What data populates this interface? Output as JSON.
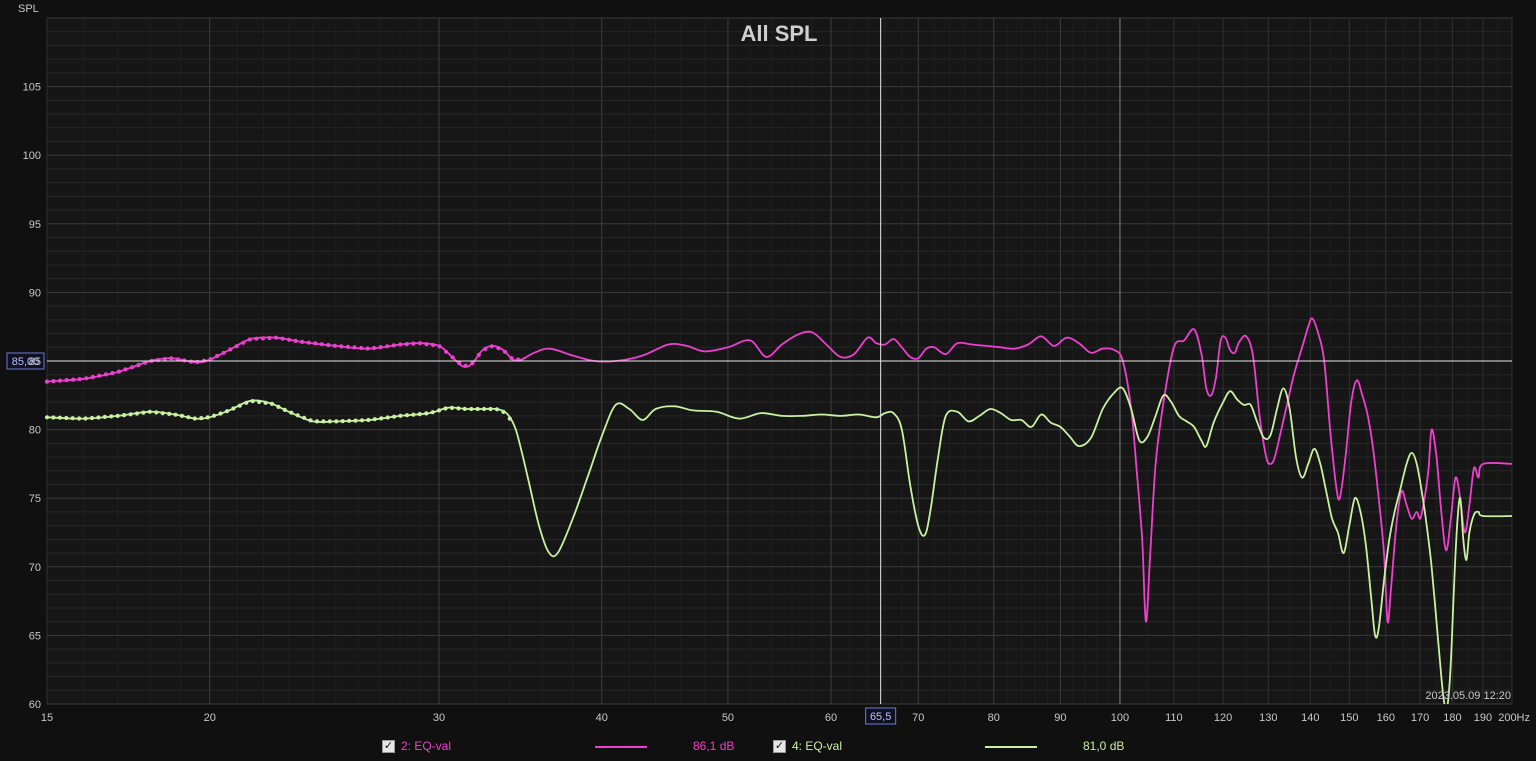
{
  "chart_data": {
    "type": "line",
    "title": "All SPL",
    "ylabel": "SPL",
    "x_scale": "log",
    "xlim": [
      15,
      200
    ],
    "ylim": [
      60,
      110
    ],
    "x_ticks": [
      {
        "value": 15,
        "label": "15"
      },
      {
        "value": 20,
        "label": "20"
      },
      {
        "value": 30,
        "label": "30"
      },
      {
        "value": 40,
        "label": "40"
      },
      {
        "value": 50,
        "label": "50"
      },
      {
        "value": 60,
        "label": "60"
      },
      {
        "value": 70,
        "label": "70"
      },
      {
        "value": 80,
        "label": "80"
      },
      {
        "value": 90,
        "label": "90"
      },
      {
        "value": 100,
        "label": "100"
      },
      {
        "value": 110,
        "label": "110"
      },
      {
        "value": 120,
        "label": "120"
      },
      {
        "value": 130,
        "label": "130"
      },
      {
        "value": 140,
        "label": "140"
      },
      {
        "value": 150,
        "label": "150"
      },
      {
        "value": 160,
        "label": "160"
      },
      {
        "value": 170,
        "label": "170"
      },
      {
        "value": 180,
        "label": "180"
      },
      {
        "value": 190,
        "label": "190"
      },
      {
        "value": 200,
        "label": "200Hz"
      }
    ],
    "y_ticks": [
      60,
      65,
      70,
      75,
      80,
      85,
      90,
      95,
      100,
      105
    ],
    "grid": true,
    "cursor": {
      "x": 65.5,
      "x_label": "65,5",
      "y": 85.0,
      "y_label": "85,00"
    },
    "timestamp": "2023.05.09 12:20",
    "series": [
      {
        "name": "2: EQ-val",
        "color": "#ee3fcf",
        "legend_value": "86,1 dB",
        "checked": true,
        "markers_until": 34.5,
        "points": [
          [
            15,
            83.5
          ],
          [
            16,
            83.7
          ],
          [
            17,
            84.2
          ],
          [
            18,
            85.0
          ],
          [
            18.7,
            85.2
          ],
          [
            19.5,
            84.9
          ],
          [
            20,
            85.1
          ],
          [
            20.7,
            85.8
          ],
          [
            21.5,
            86.6
          ],
          [
            22.5,
            86.7
          ],
          [
            23.5,
            86.4
          ],
          [
            25,
            86.1
          ],
          [
            26.5,
            85.9
          ],
          [
            28,
            86.2
          ],
          [
            29,
            86.3
          ],
          [
            30,
            86.1
          ],
          [
            30.7,
            85.3
          ],
          [
            31.3,
            84.6
          ],
          [
            31.8,
            84.8
          ],
          [
            32.4,
            85.8
          ],
          [
            33,
            86.1
          ],
          [
            33.6,
            85.8
          ],
          [
            34.2,
            85.1
          ],
          [
            34.7,
            85.1
          ],
          [
            35.5,
            85.6
          ],
          [
            36.5,
            85.9
          ],
          [
            38,
            85.4
          ],
          [
            39.5,
            85.0
          ],
          [
            41,
            85.0
          ],
          [
            43,
            85.4
          ],
          [
            45,
            86.2
          ],
          [
            46.5,
            86.1
          ],
          [
            48,
            85.7
          ],
          [
            50,
            86.0
          ],
          [
            52,
            86.5
          ],
          [
            53.5,
            85.3
          ],
          [
            55,
            86.2
          ],
          [
            56.5,
            86.9
          ],
          [
            58,
            87.1
          ],
          [
            59.5,
            86.2
          ],
          [
            61,
            85.3
          ],
          [
            62.5,
            85.5
          ],
          [
            64,
            86.7
          ],
          [
            65,
            86.3
          ],
          [
            66,
            86.2
          ],
          [
            67,
            86.6
          ],
          [
            68,
            86.0
          ],
          [
            69,
            85.3
          ],
          [
            70,
            85.2
          ],
          [
            71,
            85.9
          ],
          [
            72,
            86.0
          ],
          [
            73.5,
            85.5
          ],
          [
            75,
            86.3
          ],
          [
            77,
            86.2
          ],
          [
            79,
            86.1
          ],
          [
            81,
            86.0
          ],
          [
            83,
            85.9
          ],
          [
            85,
            86.2
          ],
          [
            87,
            86.8
          ],
          [
            89,
            86.1
          ],
          [
            91,
            86.7
          ],
          [
            93,
            86.3
          ],
          [
            95,
            85.6
          ],
          [
            97,
            85.9
          ],
          [
            99,
            85.8
          ],
          [
            100.5,
            85.0
          ],
          [
            102,
            81.5
          ],
          [
            103,
            77
          ],
          [
            104,
            72
          ],
          [
            104.7,
            66.0
          ],
          [
            105.5,
            71
          ],
          [
            106.5,
            77.5
          ],
          [
            108,
            82
          ],
          [
            110,
            86.0
          ],
          [
            112,
            86.5
          ],
          [
            114,
            87.3
          ],
          [
            115.5,
            85.5
          ],
          [
            116.5,
            83
          ],
          [
            117.5,
            82.5
          ],
          [
            118.5,
            83.8
          ],
          [
            119.5,
            86.5
          ],
          [
            120.5,
            86.7
          ],
          [
            121.5,
            85.8
          ],
          [
            122.5,
            85.6
          ],
          [
            123.5,
            86.4
          ],
          [
            125,
            86.8
          ],
          [
            126.5,
            85.4
          ],
          [
            128,
            81
          ],
          [
            129.5,
            78
          ],
          [
            130.5,
            77.5
          ],
          [
            131.5,
            78
          ],
          [
            133,
            80
          ],
          [
            134.5,
            82
          ],
          [
            136,
            84
          ],
          [
            138,
            86
          ],
          [
            139.5,
            87.5
          ],
          [
            140.5,
            88.1
          ],
          [
            142,
            87
          ],
          [
            143.5,
            85
          ],
          [
            145,
            80
          ],
          [
            146.5,
            76
          ],
          [
            147.5,
            75
          ],
          [
            149,
            78
          ],
          [
            150.5,
            82
          ],
          [
            152,
            83.6
          ],
          [
            153.5,
            82.5
          ],
          [
            155,
            81
          ],
          [
            156.5,
            78.5
          ],
          [
            158,
            75
          ],
          [
            159.5,
            71
          ],
          [
            160.5,
            66
          ],
          [
            161.5,
            68.5
          ],
          [
            163,
            73
          ],
          [
            164.5,
            75.5
          ],
          [
            166,
            74.5
          ],
          [
            167.5,
            73.5
          ],
          [
            169,
            74
          ],
          [
            170,
            73.5
          ],
          [
            171,
            74.5
          ],
          [
            172.5,
            77
          ],
          [
            173.5,
            80
          ],
          [
            175,
            78
          ],
          [
            176.5,
            74
          ],
          [
            178,
            71.2
          ],
          [
            179.5,
            73.5
          ],
          [
            181,
            76.5
          ],
          [
            182.5,
            75
          ],
          [
            184,
            72.5
          ],
          [
            185.5,
            74.5
          ],
          [
            187,
            77.2
          ],
          [
            188.5,
            76.5
          ],
          [
            190,
            77.5
          ],
          [
            200,
            77.5
          ]
        ]
      },
      {
        "name": "4: EQ-val",
        "color": "#c8f2a0",
        "legend_value": "81,0 dB",
        "checked": true,
        "markers_until": 34.0,
        "points": [
          [
            15,
            80.9
          ],
          [
            16,
            80.8
          ],
          [
            17,
            81.0
          ],
          [
            18,
            81.3
          ],
          [
            18.8,
            81.1
          ],
          [
            19.5,
            80.8
          ],
          [
            20,
            80.9
          ],
          [
            20.7,
            81.4
          ],
          [
            21.5,
            82.1
          ],
          [
            22.3,
            81.9
          ],
          [
            23,
            81.3
          ],
          [
            24,
            80.6
          ],
          [
            25,
            80.6
          ],
          [
            26.5,
            80.7
          ],
          [
            28,
            81.0
          ],
          [
            29.5,
            81.2
          ],
          [
            30.5,
            81.6
          ],
          [
            31.5,
            81.5
          ],
          [
            32.5,
            81.5
          ],
          [
            33.2,
            81.5
          ],
          [
            33.8,
            81.2
          ],
          [
            34.3,
            80.2
          ],
          [
            34.7,
            78.5
          ],
          [
            35.2,
            76
          ],
          [
            35.8,
            73
          ],
          [
            36.4,
            71.1
          ],
          [
            37,
            71
          ],
          [
            38,
            73.5
          ],
          [
            39,
            76.5
          ],
          [
            40,
            79.5
          ],
          [
            41,
            81.8
          ],
          [
            42,
            81.5
          ],
          [
            43,
            80.7
          ],
          [
            44,
            81.5
          ],
          [
            45.5,
            81.7
          ],
          [
            47,
            81.4
          ],
          [
            49,
            81.3
          ],
          [
            51,
            80.8
          ],
          [
            53,
            81.2
          ],
          [
            55,
            81.0
          ],
          [
            57,
            81.0
          ],
          [
            59,
            81.1
          ],
          [
            61,
            81.0
          ],
          [
            63,
            81.1
          ],
          [
            65,
            80.9
          ],
          [
            66,
            81.2
          ],
          [
            67,
            81.2
          ],
          [
            68,
            80
          ],
          [
            69,
            76
          ],
          [
            70,
            73
          ],
          [
            70.8,
            72.3
          ],
          [
            71.5,
            74
          ],
          [
            72.5,
            78
          ],
          [
            73.5,
            81
          ],
          [
            75,
            81.3
          ],
          [
            76.5,
            80.6
          ],
          [
            78,
            81
          ],
          [
            79.5,
            81.5
          ],
          [
            81,
            81.2
          ],
          [
            82.5,
            80.7
          ],
          [
            84,
            80.7
          ],
          [
            85.5,
            80.2
          ],
          [
            87,
            81.1
          ],
          [
            88.5,
            80.5
          ],
          [
            90,
            80.2
          ],
          [
            91.5,
            79.5
          ],
          [
            93,
            78.8
          ],
          [
            95,
            79.4
          ],
          [
            97,
            81.5
          ],
          [
            99,
            82.7
          ],
          [
            100.5,
            83.0
          ],
          [
            102,
            81.5
          ],
          [
            103.5,
            79.2
          ],
          [
            105,
            79.5
          ],
          [
            106.5,
            81
          ],
          [
            108,
            82.5
          ],
          [
            109.5,
            82
          ],
          [
            111,
            81
          ],
          [
            112.5,
            80.6
          ],
          [
            114,
            80.2
          ],
          [
            115.5,
            79.2
          ],
          [
            116.5,
            78.8
          ],
          [
            118,
            80.5
          ],
          [
            120,
            82
          ],
          [
            121.5,
            82.8
          ],
          [
            123,
            82.2
          ],
          [
            124.5,
            81.8
          ],
          [
            126,
            81.8
          ],
          [
            127.5,
            80.5
          ],
          [
            129,
            79.4
          ],
          [
            130.5,
            79.6
          ],
          [
            132,
            81.5
          ],
          [
            133.5,
            83.0
          ],
          [
            135,
            81.5
          ],
          [
            136.5,
            78
          ],
          [
            138,
            76.5
          ],
          [
            139.5,
            77.5
          ],
          [
            141,
            78.6
          ],
          [
            142.5,
            77.5
          ],
          [
            144,
            75.5
          ],
          [
            145.5,
            73.5
          ],
          [
            147,
            72.5
          ],
          [
            148.5,
            71
          ],
          [
            150,
            73
          ],
          [
            151.5,
            75
          ],
          [
            153,
            74
          ],
          [
            154.5,
            71.5
          ],
          [
            156,
            67.5
          ],
          [
            157,
            65
          ],
          [
            158,
            65.5
          ],
          [
            159.5,
            69
          ],
          [
            161,
            72
          ],
          [
            162.5,
            74
          ],
          [
            164,
            75.5
          ],
          [
            166,
            77.5
          ],
          [
            167.5,
            78.3
          ],
          [
            169,
            77.5
          ],
          [
            170.5,
            75.5
          ],
          [
            172,
            73
          ],
          [
            173.5,
            70
          ],
          [
            175,
            66
          ],
          [
            176.5,
            62
          ],
          [
            177.5,
            60
          ],
          [
            178.5,
            60
          ],
          [
            179.5,
            63
          ],
          [
            180.5,
            68.5
          ],
          [
            181.5,
            73
          ],
          [
            182.5,
            75
          ],
          [
            183.5,
            72
          ],
          [
            184.5,
            70.5
          ],
          [
            185.5,
            72.5
          ],
          [
            187,
            73.8
          ],
          [
            188.5,
            74
          ],
          [
            190,
            73.7
          ],
          [
            200,
            73.7
          ]
        ]
      }
    ]
  }
}
